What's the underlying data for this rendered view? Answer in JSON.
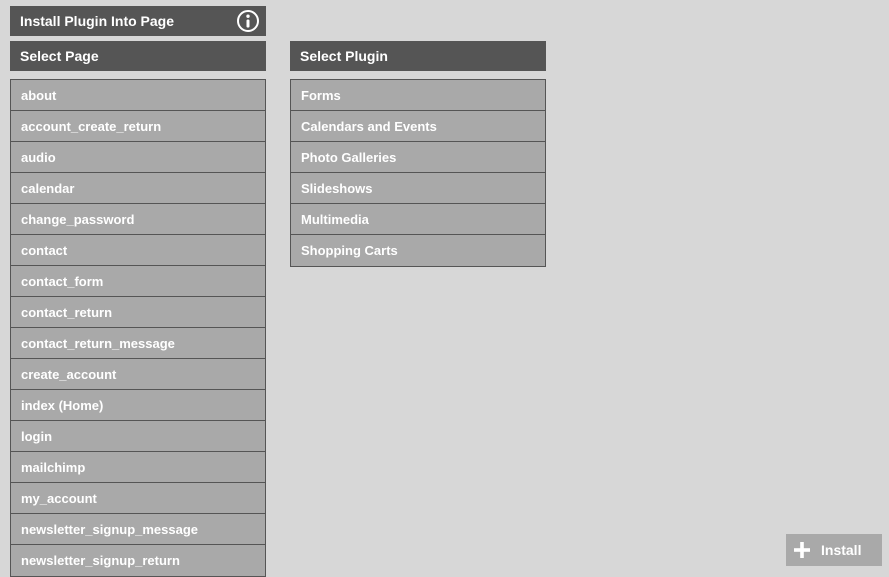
{
  "titleBar": {
    "label": "Install Plugin Into Page"
  },
  "pageSelector": {
    "header": "Select Page",
    "items": [
      "about",
      "account_create_return",
      "audio",
      "calendar",
      "change_password",
      "contact",
      "contact_form",
      "contact_return",
      "contact_return_message",
      "create_account",
      "index (Home)",
      "login",
      "mailchimp",
      "my_account",
      "newsletter_signup_message",
      "newsletter_signup_return"
    ]
  },
  "pluginSelector": {
    "header": "Select Plugin",
    "items": [
      "Forms",
      "Calendars and Events",
      "Photo Galleries",
      "Slideshows",
      "Multimedia",
      "Shopping Carts"
    ]
  },
  "installButton": {
    "label": "Install"
  }
}
